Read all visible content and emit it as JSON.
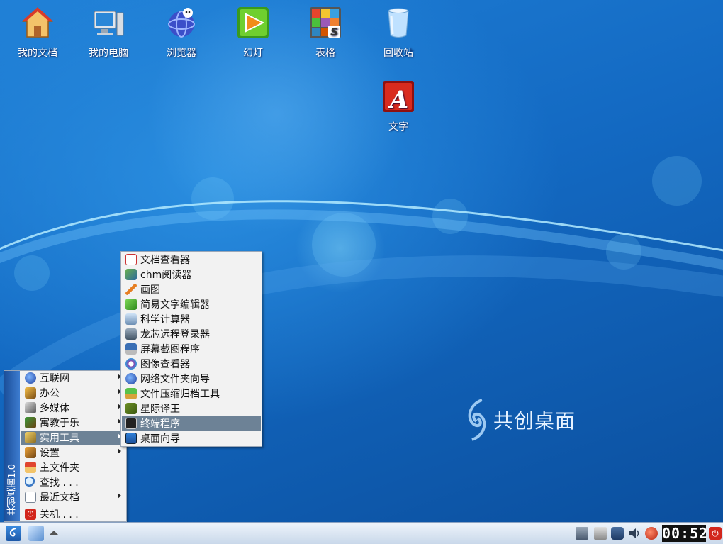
{
  "desktop": {
    "icons": [
      {
        "label": "我的文档",
        "icon": "house-icon"
      },
      {
        "label": "我的电脑",
        "icon": "computer-icon"
      },
      {
        "label": "浏览器",
        "icon": "browser-globe-icon"
      },
      {
        "label": "幻灯",
        "icon": "slideshow-icon"
      },
      {
        "label": "表格",
        "icon": "spreadsheet-icon"
      },
      {
        "label": "回收站",
        "icon": "trash-icon"
      },
      {
        "label": "文字",
        "icon": "text-editor-icon"
      }
    ],
    "brand_text": "共创桌面",
    "colors": {
      "background": "#1369c2",
      "menu_bg": "#f2f2f2",
      "menu_highlight": "#6d8296",
      "stripe": "#1b4f99"
    }
  },
  "start_menu": {
    "stripe_text": "共创桌面1.0",
    "items": [
      {
        "label": "互联网",
        "icon": "globe-icon",
        "submenu": true
      },
      {
        "label": "办公",
        "icon": "office-icon",
        "submenu": true
      },
      {
        "label": "多媒体",
        "icon": "multimedia-icon",
        "submenu": true
      },
      {
        "label": "寓教于乐",
        "icon": "education-icon",
        "submenu": true
      },
      {
        "label": "实用工具",
        "icon": "tools-icon",
        "submenu": true,
        "selected": true
      },
      {
        "label": "设置",
        "icon": "settings-icon",
        "submenu": true
      },
      {
        "label": "主文件夹",
        "icon": "home-folder-icon",
        "submenu": false
      },
      {
        "label": "查找 . . .",
        "icon": "find-icon",
        "submenu": false
      },
      {
        "label": "最近文档",
        "icon": "recent-documents-icon",
        "submenu": true
      },
      {
        "label": "关机 . . .",
        "icon": "shutdown-icon",
        "submenu": false
      }
    ]
  },
  "tools_submenu": {
    "items": [
      {
        "label": "文档查看器",
        "icon": "document-viewer-icon"
      },
      {
        "label": "chm阅读器",
        "icon": "chm-reader-icon"
      },
      {
        "label": "画图",
        "icon": "paint-icon"
      },
      {
        "label": "简易文字编辑器",
        "icon": "text-editor-icon"
      },
      {
        "label": "科学计算器",
        "icon": "calculator-icon"
      },
      {
        "label": "龙芯远程登录器",
        "icon": "remote-login-icon"
      },
      {
        "label": "屏幕截图程序",
        "icon": "screenshot-icon"
      },
      {
        "label": "图像查看器",
        "icon": "image-viewer-icon"
      },
      {
        "label": "网络文件夹向导",
        "icon": "network-folder-icon"
      },
      {
        "label": "文件压缩归档工具",
        "icon": "archive-icon"
      },
      {
        "label": "星际译王",
        "icon": "dictionary-icon"
      },
      {
        "label": "终端程序",
        "icon": "terminal-icon",
        "selected": true
      },
      {
        "label": "桌面向导",
        "icon": "desktop-wizard-icon"
      }
    ]
  },
  "taskbar": {
    "clock": "00:52",
    "launchers": [
      "start-logo-icon",
      "show-desktop-icon",
      "eject-icon"
    ],
    "tray": [
      "network-icon",
      "printer-icon",
      "usb-icon",
      "volume-icon",
      "input-method-icon"
    ],
    "power_icon": "power-icon"
  }
}
